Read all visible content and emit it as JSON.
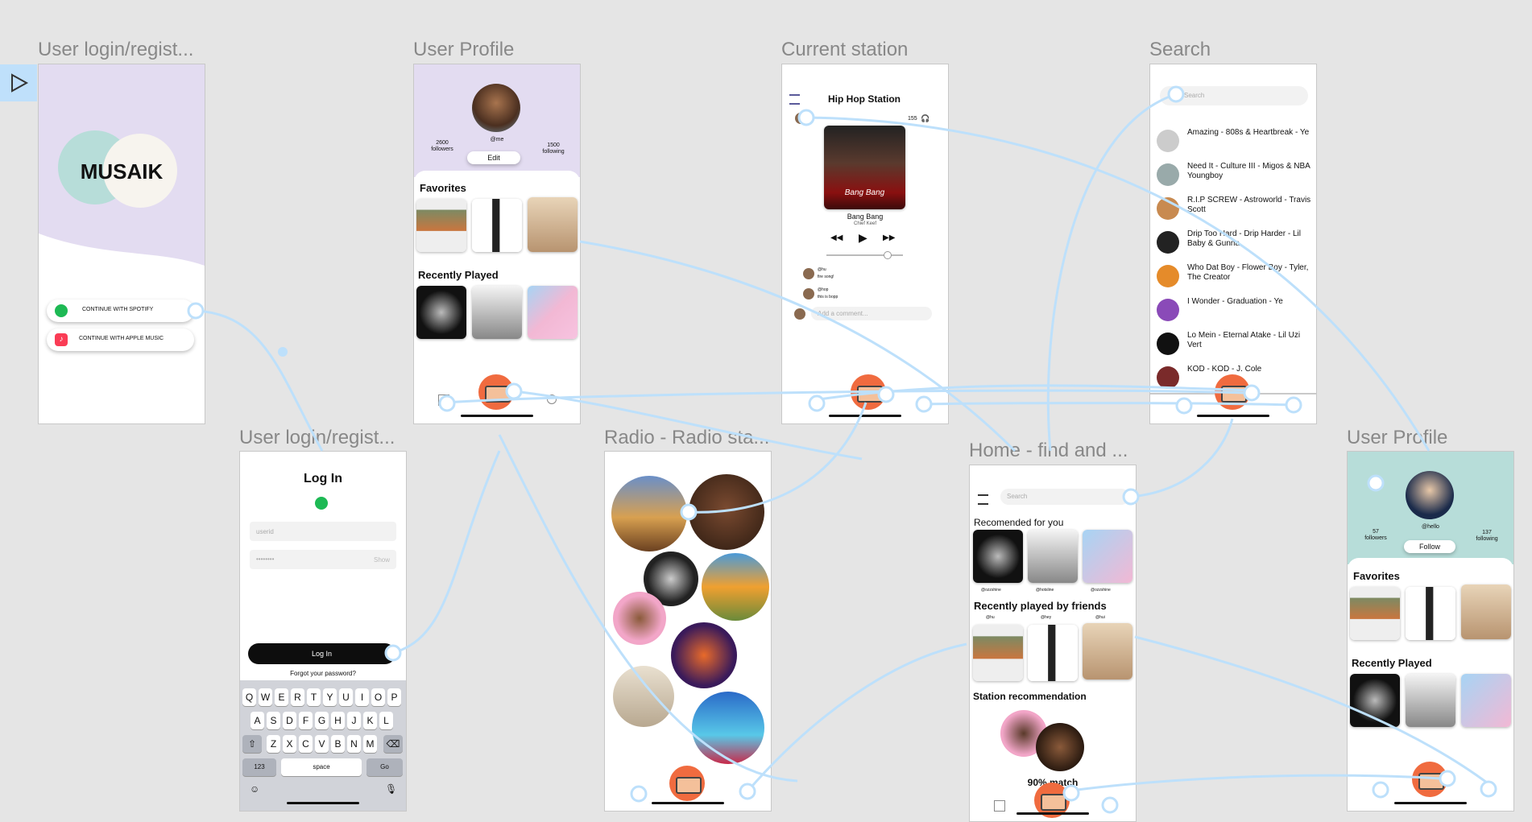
{
  "frames": {
    "login1": {
      "label": "User login/regist...",
      "logo": "MUSAIK",
      "spotify": "CONTINUE WITH SPOTIFY",
      "apple": "CONTINUE WITH APPLE MUSIC"
    },
    "profile1": {
      "label": "User Profile",
      "handle": "@me",
      "followers": "2600",
      "followers_label": "followers",
      "following": "1500",
      "following_label": "following",
      "edit": "Edit",
      "favorites": "Favorites",
      "recent": "Recently Played"
    },
    "station": {
      "label": "Current station",
      "title": "Hip Hop Station",
      "listeners": "155",
      "song": "Bang Bang",
      "artist": "Chief Keef",
      "album_text": "Bang Bang",
      "c1_user": "@hu",
      "c1_text": "fire song!",
      "c2_user": "@hop",
      "c2_text": "this is bopp",
      "comment_placeholder": "Add a comment..."
    },
    "search": {
      "label": "Search",
      "placeholder": "Search",
      "results": [
        "Amazing - 808s & Heartbreak - Ye",
        "Need It - Culture III - Migos & NBA Youngboy",
        "R.I.P SCREW - Astroworld - Travis Scott",
        "Drip Too Hard - Drip Harder - Lil Baby & Gunna",
        "Who Dat Boy - Flower Boy - Tyler, The Creator",
        "I Wonder - Graduation - Ye",
        "Lo Mein - Eternal Atake - Lil Uzi Vert",
        "KOD - KOD - J. Cole"
      ]
    },
    "login2": {
      "label": "User login/regist...",
      "title": "Log In",
      "userid": "userid",
      "password": "••••••••",
      "show": "Show",
      "login": "Log In",
      "forgot": "Forgot your password?",
      "row1": [
        "Q",
        "W",
        "E",
        "R",
        "T",
        "Y",
        "U",
        "I",
        "O",
        "P"
      ],
      "row2": [
        "A",
        "S",
        "D",
        "F",
        "G",
        "H",
        "J",
        "K",
        "L"
      ],
      "row3": [
        "Z",
        "X",
        "C",
        "V",
        "B",
        "N",
        "M"
      ],
      "num": "123",
      "space": "space",
      "go": "Go"
    },
    "radio": {
      "label": "Radio - Radio sta..."
    },
    "home": {
      "label": "Home - find and ...",
      "search": "Search",
      "rec": "Recomended for you",
      "rec_users": [
        "@ozzshine",
        "@hotsline",
        "@ozzshine"
      ],
      "friends": "Recently played by friends",
      "friend_users": [
        "@hu",
        "@hey",
        "@hui"
      ],
      "station_rec": "Station recommendation",
      "match": "90% match"
    },
    "profile2": {
      "label": "User Profile",
      "handle": "@hello",
      "followers": "57",
      "followers_label": "followers",
      "following": "137",
      "following_label": "following",
      "follow": "Follow",
      "favorites": "Favorites",
      "recent": "Recently Played"
    }
  },
  "colors": {
    "wire": "#bde0fb",
    "lavender": "#e3dcf1",
    "mint": "#b7ddd9",
    "accent": "#f06b3f"
  }
}
